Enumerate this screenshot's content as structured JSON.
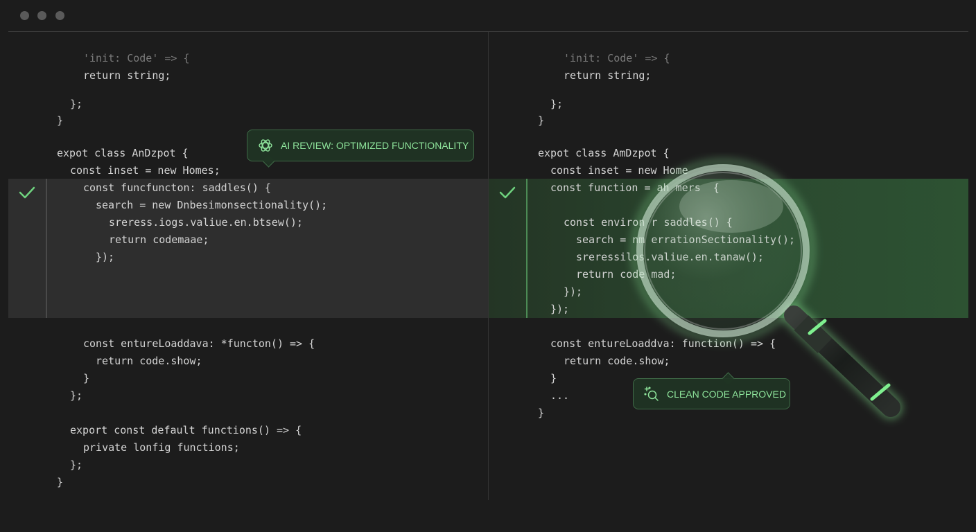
{
  "window": {
    "controls": [
      "close",
      "minimize",
      "maximize"
    ],
    "colors": {
      "background": "#1c1c1c",
      "accent": "#8fe59c",
      "highlight_right": "#2b4a30"
    }
  },
  "left_pane": {
    "lines": [
      "'init: Code' => {",
      "return string;",
      "};",
      "}",
      "expot class AnDzpot {",
      "const inset = new Homes;",
      "const funcfuncton: saddles() {",
      "search = new Dnbesimonsectionality();",
      "sreress.iogs.valiue.en.btsew();",
      "return codemaae;",
      "});",
      "const entureLoaddava: *functon() => {",
      "return code.show;",
      "}",
      "};",
      "export const default functions() => {",
      "private lonfig functions;",
      "};",
      "}"
    ]
  },
  "right_pane": {
    "lines": [
      "'init: Code' => {",
      "return string;",
      "};",
      "}",
      "expot class AmDzpot {",
      "const inset = new Home",
      "const function = ah mers  {",
      "const environ r saddles() {",
      "search = nm errationSectionality();",
      "sreressilos.valiue.en.tanaw();",
      "return code mad;",
      "});",
      "});",
      "const entureLoaddva: function() => {",
      "return code.show;",
      "}",
      "...",
      "}"
    ]
  },
  "badges": {
    "ai_review": {
      "label": "AI REVIEW: OPTIMIZED FUNCTIONALITY",
      "icon": "openai-logo-icon"
    },
    "clean_code": {
      "label": "CLEAN CODE APPROVED",
      "icon": "sparkle-search-icon"
    }
  },
  "icons": {
    "left_gutter": "checkmark-icon",
    "right_gutter": "checkmark-icon",
    "overlay": "magnifying-glass-icon"
  }
}
